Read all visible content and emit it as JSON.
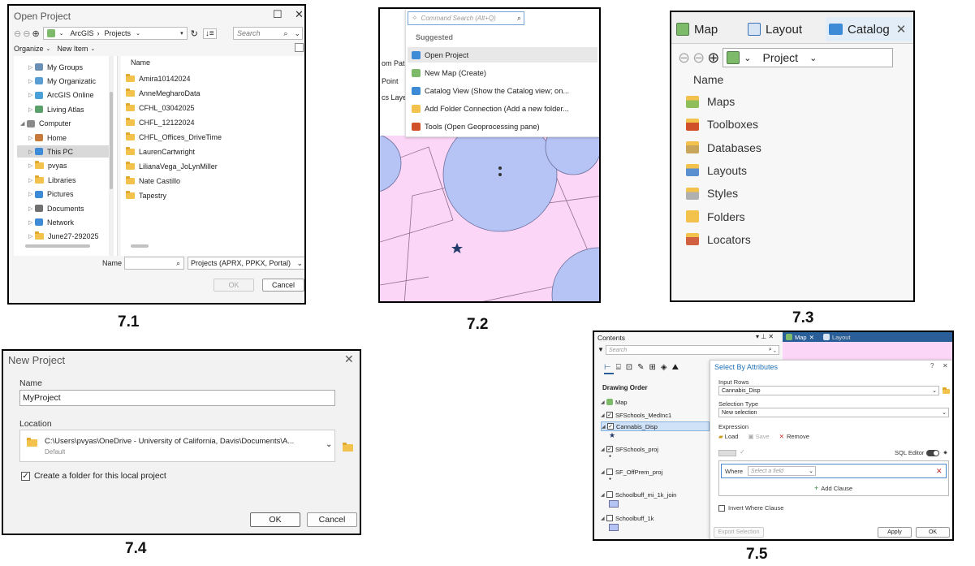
{
  "captions": [
    "7.1",
    "7.2",
    "7.3",
    "7.4",
    "7.5"
  ],
  "p71": {
    "title": "Open Project",
    "path": [
      "ArcGIS",
      "Projects"
    ],
    "search_placeholder": "Search",
    "organize": "Organize",
    "new_item": "New Item",
    "nav": [
      {
        "label": "My Groups",
        "indent": 1
      },
      {
        "label": "My Organizatic",
        "indent": 1
      },
      {
        "label": "ArcGIS Online",
        "indent": 1
      },
      {
        "label": "Living Atlas",
        "indent": 1
      },
      {
        "label": "Computer",
        "indent": 0
      },
      {
        "label": "Home",
        "indent": 1
      },
      {
        "label": "This PC",
        "indent": 1
      },
      {
        "label": "pvyas",
        "indent": 1
      },
      {
        "label": "Libraries",
        "indent": 1
      },
      {
        "label": "Pictures",
        "indent": 1
      },
      {
        "label": "Documents",
        "indent": 1
      },
      {
        "label": "Network",
        "indent": 1
      },
      {
        "label": "June27-292025",
        "indent": 1
      }
    ],
    "column_header": "Name",
    "files": [
      "Amira10142024",
      "AnneMegharoData",
      "CFHL_03042025",
      "CHFL_12122024",
      "CHFL_Offices_DriveTime",
      "LaurenCartwright",
      "LilianaVega_JoLynMiller",
      "Nate Castillo",
      "Tapestry"
    ],
    "name_label": "Name",
    "filter": "Projects (APRX, PPKX, Portal)",
    "ok": "OK",
    "cancel": "Cancel"
  },
  "p72": {
    "search_placeholder": "Command Search (Alt+Q)",
    "suggested": "Suggested",
    "items": [
      "Open Project",
      "New Map (Create)",
      "Catalog View (Show the Catalog view; on...",
      "Add Folder Connection (Add a new folder...",
      "Tools (Open Geoprocessing pane)"
    ],
    "side_text": [
      "om Pat",
      "Point",
      "cs Laye"
    ]
  },
  "p73": {
    "tabs": [
      "Map",
      "Layout",
      "Catalog"
    ],
    "location": "Project",
    "header": "Name",
    "items": [
      "Maps",
      "Toolboxes",
      "Databases",
      "Layouts",
      "Styles",
      "Folders",
      "Locators"
    ]
  },
  "p74": {
    "title": "New Project",
    "name_label": "Name",
    "name_value": "MyProject",
    "location_label": "Location",
    "location_path": "C:\\Users\\pvyas\\OneDrive - University of California, Davis\\Documents\\A...",
    "location_default": "Default",
    "create_folder": "Create a folder for this local project",
    "ok": "OK",
    "cancel": "Cancel"
  },
  "p75": {
    "contents_title": "Contents",
    "tabs": [
      "Map",
      "Layout"
    ],
    "search_placeholder": "Search",
    "drawing_order": "Drawing Order",
    "layers": [
      "Map",
      "SFSchools_MedInc1",
      "Cannabis_Disp",
      "SFSchools_proj",
      "SF_OffPrem_proj",
      "Schoolbuff_mi_1k_join",
      "Schoolbuff_1k"
    ],
    "sba_title": "Select By Attributes",
    "input_rows_label": "Input Rows",
    "input_rows_value": "Cannabis_Disp",
    "selection_type_label": "Selection Type",
    "selection_type_value": "New selection",
    "expression_label": "Expression",
    "load": "Load",
    "save": "Save",
    "remove": "Remove",
    "sql_editor": "SQL Editor",
    "where": "Where",
    "select_field": "Select a field",
    "add_clause": "Add Clause",
    "invert": "Invert Where Clause",
    "export_selection": "Export Selection",
    "apply": "Apply",
    "ok": "OK"
  },
  "colors": {
    "map_pink": "#fcd6f6",
    "map_blue": "#b6c3f5",
    "arcgis_blue": "#1f6fb5"
  }
}
